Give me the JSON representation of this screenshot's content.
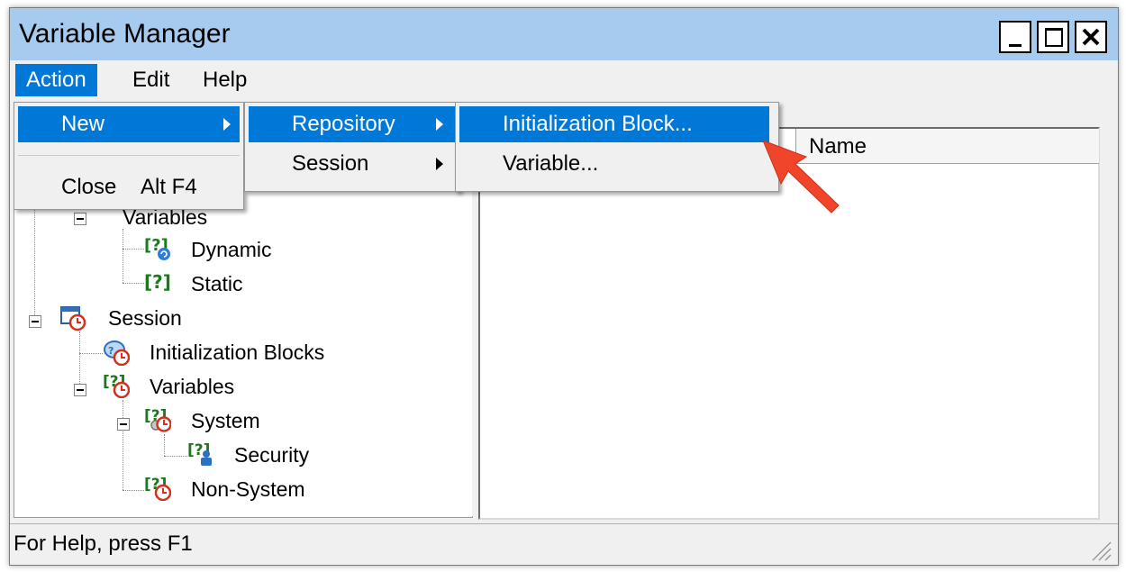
{
  "window": {
    "title": "Variable Manager",
    "minimize": "_",
    "maximize": "□",
    "close": "✕"
  },
  "menubar": {
    "action": "Action",
    "edit": "Edit",
    "help": "Help"
  },
  "action_menu": {
    "new": "New",
    "close": "Close",
    "close_shortcut": "Alt F4"
  },
  "new_menu": {
    "repository": "Repository",
    "session": "Session"
  },
  "repository_menu": {
    "init_block": "Initialization Block...",
    "variable": "Variable..."
  },
  "list": {
    "column_name": "Name"
  },
  "tree": {
    "variables_partial": "Variables",
    "dynamic": "Dynamic",
    "static": "Static",
    "session": "Session",
    "init_blocks": "Initialization Blocks",
    "session_variables": "Variables",
    "system": "System",
    "security": "Security",
    "non_system": "Non-System"
  },
  "status": {
    "text": "For Help, press F1"
  },
  "colors": {
    "accent": "#0078d7",
    "titlebar": "#a6cbef",
    "annotation_arrow": "#f0452a"
  },
  "icons": [
    "variable-icon",
    "dynamic-variable-icon",
    "session-icon",
    "init-blocks-icon",
    "system-icon",
    "security-icon",
    "clock-icon",
    "arrow-annotation-icon"
  ]
}
